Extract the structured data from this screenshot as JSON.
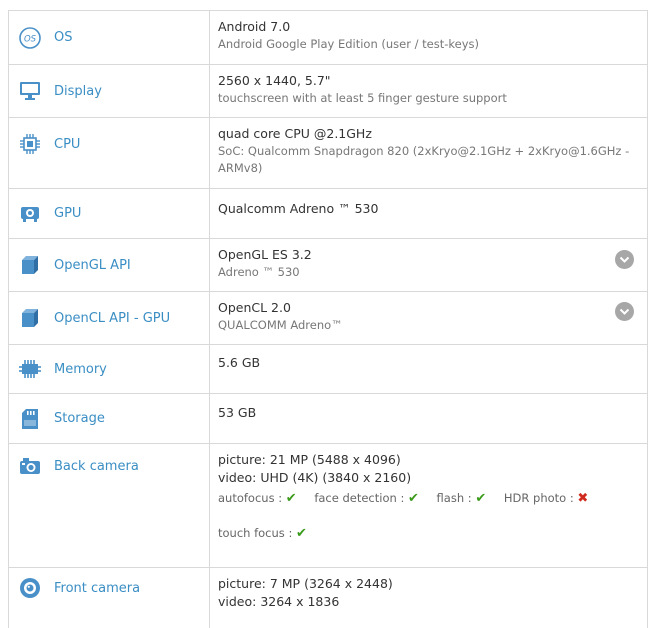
{
  "specs": {
    "os": {
      "label": "OS",
      "main": "Android 7.0",
      "sub": "Android Google Play Edition (user / test-keys)"
    },
    "display": {
      "label": "Display",
      "main": "2560 x 1440, 5.7\"",
      "sub": "touchscreen with at least 5 finger gesture support"
    },
    "cpu": {
      "label": "CPU",
      "main": "quad core CPU @2.1GHz",
      "sub1": "SoC: Qualcomm Snapdragon 820 (2xKryo@2.1GHz + 2xKryo@1.6GHz -",
      "sub2": "ARMv8)"
    },
    "gpu": {
      "label": "GPU",
      "main": "Qualcomm Adreno ™ 530"
    },
    "opengl": {
      "label": "OpenGL API",
      "main": "OpenGL ES 3.2",
      "sub": "Adreno ™ 530"
    },
    "opencl": {
      "label": "OpenCL API - GPU",
      "main": "OpenCL 2.0",
      "sub": "QUALCOMM Adreno™"
    },
    "memory": {
      "label": "Memory",
      "main": "5.6 GB"
    },
    "storage": {
      "label": "Storage",
      "main": "53 GB"
    },
    "back_camera": {
      "label": "Back camera",
      "picture": "picture: 21 MP (5488 x 4096)",
      "video": "video: UHD (4K) (3840 x 2160)",
      "features": {
        "autofocus": "autofocus :",
        "face_detection": "face detection :",
        "flash": "flash :",
        "hdr_photo": "HDR photo :",
        "touch_focus": "touch focus :"
      }
    },
    "front_camera": {
      "label": "Front camera",
      "picture": "picture: 7 MP (3264 x 2448)",
      "video": "video: 3264 x 1836"
    }
  },
  "glyphs": {
    "check": "✔",
    "cross": "✖"
  },
  "colors": {
    "label_blue": "#3a8ec4",
    "icon_blue": "#4a90c8",
    "check_green": "#3a9a1a",
    "cross_red": "#d02a1e"
  },
  "icons": [
    "os-icon",
    "monitor-icon",
    "cpu-chip-icon",
    "gpu-icon",
    "cube-icon",
    "cube-icon",
    "memory-chip-icon",
    "sd-card-icon",
    "camera-icon",
    "front-camera-icon",
    "chevron-down-icon"
  ]
}
